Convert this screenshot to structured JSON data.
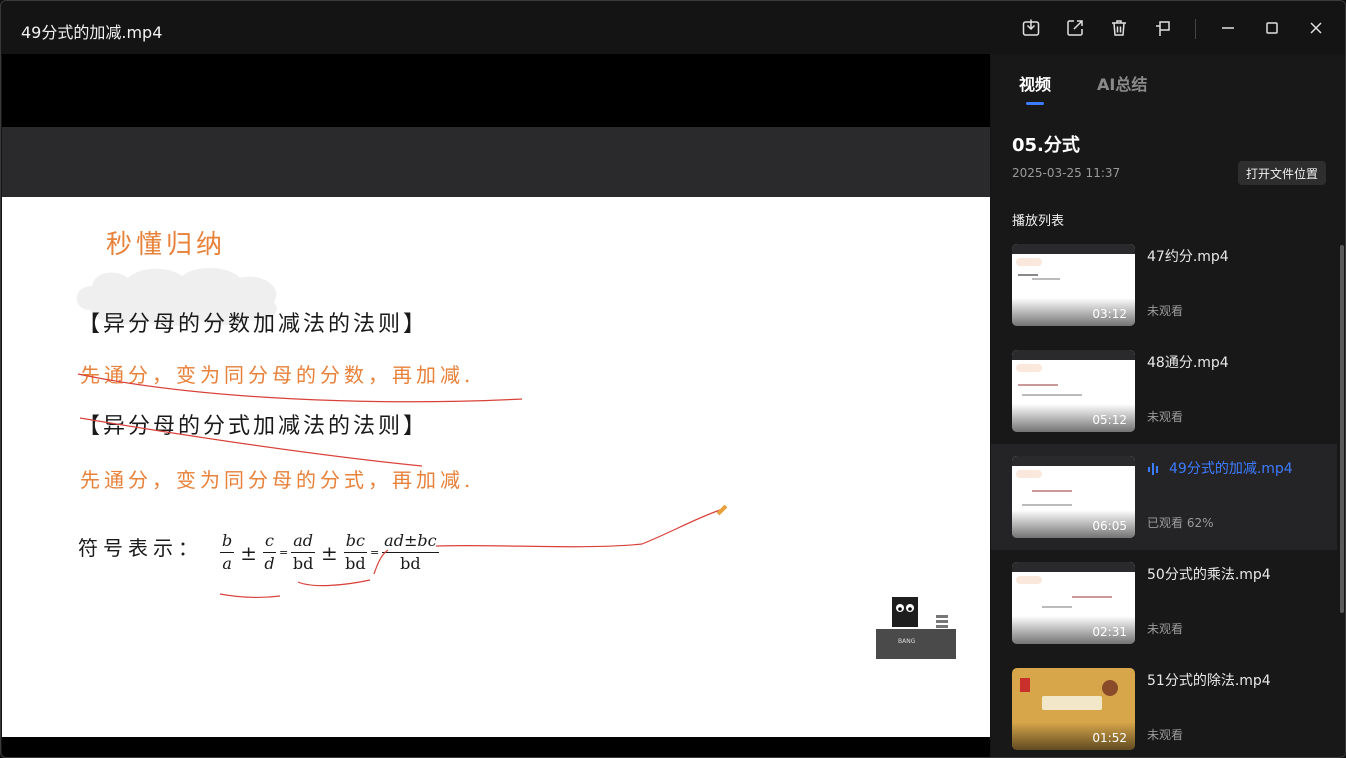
{
  "window": {
    "title": "49分式的加减.mp4",
    "buttons": [
      "download-icon",
      "share-icon",
      "delete-icon",
      "pin-icon",
      "minimize-icon",
      "maximize-icon",
      "close-icon"
    ]
  },
  "slide": {
    "heading": "秒懂归纳",
    "rule1_title": "【异分母的分数加减法的法则】",
    "rule1_body": "先通分，变为同分母的分数，再加减.",
    "rule2_title": "【异分母的分式加减法的法则】",
    "rule2_body": "先通分，变为同分母的分式，再加减.",
    "symbol_label": "符号表示：",
    "formula": {
      "f1_num": "b",
      "f1_den": "a",
      "pm1": "±",
      "f2_num": "c",
      "f2_den": "d",
      "eq1": "=",
      "f3_num": "ad",
      "f3_den": "bd",
      "pm2": "±",
      "f4_num": "bc",
      "f4_den": "bd",
      "eq2": "=",
      "f5_num": "ad±bc",
      "f5_den": "bd"
    },
    "mascot_label": "BANG"
  },
  "sidebar": {
    "tabs": [
      {
        "label": "视频",
        "active": true
      },
      {
        "label": "AI总结",
        "active": false
      }
    ],
    "folder_title": "05.分式",
    "folder_date": "2025-03-25 11:37",
    "open_location_label": "打开文件位置",
    "playlist_label": "播放列表",
    "accent": "#3d7bff",
    "items": [
      {
        "name": "47约分.mp4",
        "duration": "03:12",
        "status": "未观看",
        "active": false
      },
      {
        "name": "48通分.mp4",
        "duration": "05:12",
        "status": "未观看",
        "active": false
      },
      {
        "name": "49分式的加减.mp4",
        "duration": "06:05",
        "status": "已观看 62%",
        "active": true
      },
      {
        "name": "50分式的乘法.mp4",
        "duration": "02:31",
        "status": "未观看",
        "active": false
      },
      {
        "name": "51分式的除法.mp4",
        "duration": "01:52",
        "status": "未观看",
        "active": false
      }
    ]
  }
}
